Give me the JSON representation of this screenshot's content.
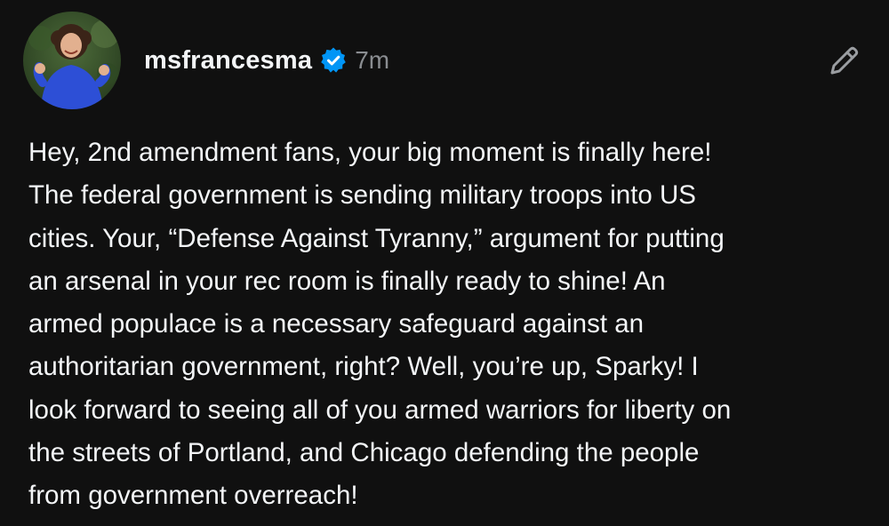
{
  "post": {
    "username": "msfrancesma",
    "verified": true,
    "timestamp": "7m",
    "avatar_icon": "profile-photo",
    "edit_icon": "pencil-icon",
    "verified_icon": "verified-badge-icon",
    "accent_color": "#0095f6",
    "background_color": "#101010",
    "text_lines": [
      "Hey, 2nd amendment fans, your big moment is finally here!",
      "The federal government is sending military troops into US",
      "cities. Your, “Defense Against Tyranny,” argument for putting",
      "an arsenal in your rec room is finally ready to shine! An",
      "armed populace is a necessary safeguard against an",
      "authoritarian government, right? Well, you’re up, Sparky! I",
      "look forward to seeing all of you armed warriors for liberty on",
      "the streets of Portland, and Chicago defending the people",
      "from government overreach!"
    ]
  }
}
